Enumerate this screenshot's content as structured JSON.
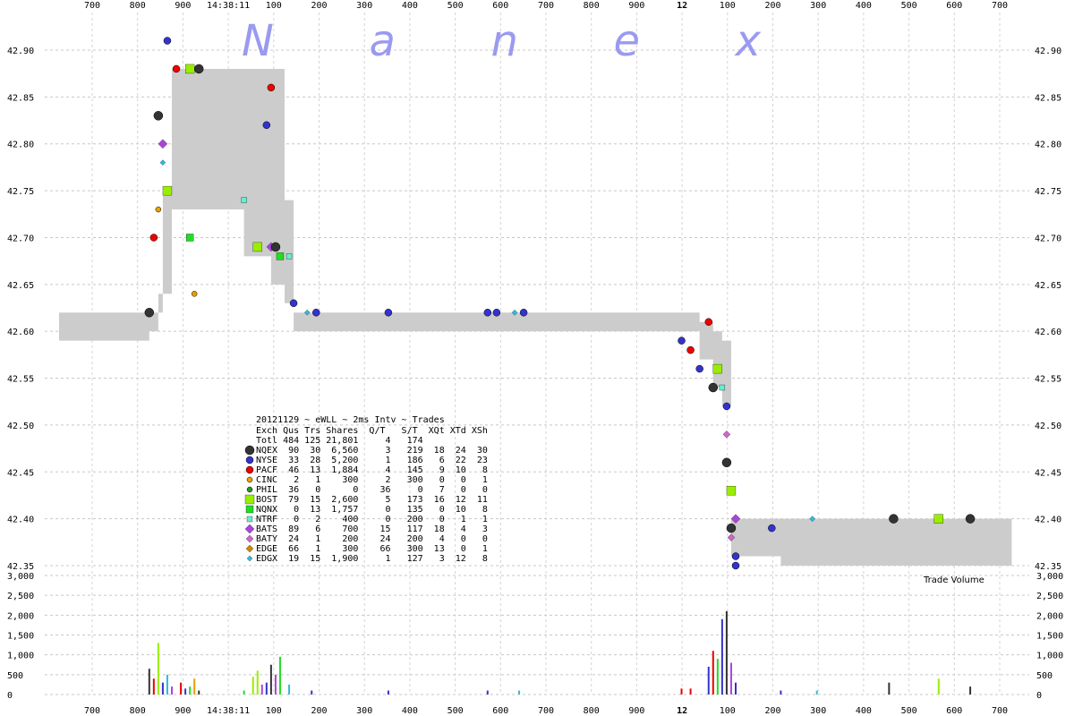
{
  "chart_data": {
    "type": "scatter",
    "watermark": "N a n e x",
    "top_ticks": [
      "700",
      "800",
      "900",
      "14:38:11",
      "100",
      "200",
      "300",
      "400",
      "500",
      "600",
      "700",
      "800",
      "900",
      "12",
      "100",
      "200",
      "300",
      "400",
      "500",
      "600",
      "700"
    ],
    "bottom_ticks": [
      "700",
      "800",
      "900",
      "14:38:11",
      "100",
      "200",
      "300",
      "400",
      "500",
      "600",
      "700",
      "800",
      "900",
      "12",
      "100",
      "200",
      "300",
      "400",
      "500",
      "600",
      "700"
    ],
    "price_ticks": [
      "42.90",
      "42.85",
      "42.80",
      "42.75",
      "42.70",
      "42.65",
      "42.60",
      "42.55",
      "42.50",
      "42.45",
      "42.40",
      "42.35"
    ],
    "price_range": [
      42.35,
      42.92
    ],
    "volume_ticks": [
      "3,000",
      "2,500",
      "2,000",
      "1,500",
      "1,000",
      "500",
      "0"
    ],
    "volume_range": [
      0,
      3000
    ],
    "volume_label": "Trade Volume",
    "nbbo_band": [
      {
        "t": 0.0,
        "bid": 42.59,
        "ask": 42.62
      },
      {
        "t": 2.0,
        "bid": 42.6,
        "ask": 42.62
      },
      {
        "t": 2.2,
        "bid": 42.62,
        "ask": 42.64
      },
      {
        "t": 2.3,
        "bid": 42.64,
        "ask": 42.75
      },
      {
        "t": 2.5,
        "bid": 42.73,
        "ask": 42.88
      },
      {
        "t": 2.8,
        "bid": 42.73,
        "ask": 42.88
      },
      {
        "t": 4.0,
        "bid": 42.73,
        "ask": 42.88
      },
      {
        "t": 4.1,
        "bid": 42.68,
        "ask": 42.88
      },
      {
        "t": 4.7,
        "bid": 42.65,
        "ask": 42.88
      },
      {
        "t": 5.0,
        "bid": 42.63,
        "ask": 42.74
      },
      {
        "t": 5.2,
        "bid": 42.6,
        "ask": 42.62
      },
      {
        "t": 14.0,
        "bid": 42.6,
        "ask": 42.62
      },
      {
        "t": 14.2,
        "bid": 42.57,
        "ask": 42.61
      },
      {
        "t": 14.5,
        "bid": 42.54,
        "ask": 42.6
      },
      {
        "t": 14.7,
        "bid": 42.52,
        "ask": 42.59
      },
      {
        "t": 14.9,
        "bid": 42.36,
        "ask": 42.4
      },
      {
        "t": 16.0,
        "bid": 42.35,
        "ask": 42.4
      },
      {
        "t": 21.0,
        "bid": 42.35,
        "ask": 42.4
      }
    ],
    "trades": [
      {
        "t": 2.0,
        "p": 42.62,
        "exch": "NQEX"
      },
      {
        "t": 2.4,
        "p": 42.91,
        "exch": "NYSE"
      },
      {
        "t": 2.6,
        "p": 42.88,
        "exch": "PACF"
      },
      {
        "t": 2.9,
        "p": 42.88,
        "exch": "BOST"
      },
      {
        "t": 3.1,
        "p": 42.88,
        "exch": "NQEX"
      },
      {
        "t": 2.2,
        "p": 42.83,
        "exch": "NQEX"
      },
      {
        "t": 2.3,
        "p": 42.8,
        "exch": "BATS"
      },
      {
        "t": 2.3,
        "p": 42.78,
        "exch": "EDGX"
      },
      {
        "t": 2.4,
        "p": 42.75,
        "exch": "BOST"
      },
      {
        "t": 2.2,
        "p": 42.73,
        "exch": "CINC"
      },
      {
        "t": 2.1,
        "p": 42.7,
        "exch": "PACF"
      },
      {
        "t": 2.9,
        "p": 42.7,
        "exch": "NQNX"
      },
      {
        "t": 3.0,
        "p": 42.64,
        "exch": "CINC"
      },
      {
        "t": 4.7,
        "p": 42.86,
        "exch": "PACF"
      },
      {
        "t": 4.6,
        "p": 42.82,
        "exch": "NYSE"
      },
      {
        "t": 4.1,
        "p": 42.74,
        "exch": "NTRF"
      },
      {
        "t": 4.4,
        "p": 42.69,
        "exch": "BOST"
      },
      {
        "t": 4.7,
        "p": 42.69,
        "exch": "BATS"
      },
      {
        "t": 4.8,
        "p": 42.69,
        "exch": "NQEX"
      },
      {
        "t": 4.9,
        "p": 42.68,
        "exch": "NQNX"
      },
      {
        "t": 5.1,
        "p": 42.68,
        "exch": "NTRF"
      },
      {
        "t": 5.2,
        "p": 42.63,
        "exch": "NYSE"
      },
      {
        "t": 5.5,
        "p": 42.62,
        "exch": "EDGX"
      },
      {
        "t": 5.7,
        "p": 42.62,
        "exch": "NYSE"
      },
      {
        "t": 7.3,
        "p": 42.62,
        "exch": "NYSE"
      },
      {
        "t": 9.5,
        "p": 42.62,
        "exch": "NYSE"
      },
      {
        "t": 9.7,
        "p": 42.62,
        "exch": "NYSE"
      },
      {
        "t": 10.1,
        "p": 42.62,
        "exch": "EDGX"
      },
      {
        "t": 10.3,
        "p": 42.62,
        "exch": "NYSE"
      },
      {
        "t": 13.8,
        "p": 42.59,
        "exch": "NYSE"
      },
      {
        "t": 14.0,
        "p": 42.58,
        "exch": "PACF"
      },
      {
        "t": 14.2,
        "p": 42.56,
        "exch": "NYSE"
      },
      {
        "t": 14.4,
        "p": 42.61,
        "exch": "PACF"
      },
      {
        "t": 14.6,
        "p": 42.56,
        "exch": "BOST"
      },
      {
        "t": 14.5,
        "p": 42.54,
        "exch": "NQEX"
      },
      {
        "t": 14.7,
        "p": 42.54,
        "exch": "NTRF"
      },
      {
        "t": 14.8,
        "p": 42.52,
        "exch": "NYSE"
      },
      {
        "t": 14.8,
        "p": 42.49,
        "exch": "BATY"
      },
      {
        "t": 14.8,
        "p": 42.46,
        "exch": "NQEX"
      },
      {
        "t": 14.9,
        "p": 42.43,
        "exch": "BOST"
      },
      {
        "t": 15.0,
        "p": 42.4,
        "exch": "BATS"
      },
      {
        "t": 14.9,
        "p": 42.39,
        "exch": "NQEX"
      },
      {
        "t": 14.9,
        "p": 42.38,
        "exch": "BATY"
      },
      {
        "t": 15.0,
        "p": 42.36,
        "exch": "NYSE"
      },
      {
        "t": 15.0,
        "p": 42.35,
        "exch": "NYSE"
      },
      {
        "t": 15.8,
        "p": 42.39,
        "exch": "NYSE"
      },
      {
        "t": 16.7,
        "p": 42.4,
        "exch": "EDGX"
      },
      {
        "t": 18.5,
        "p": 42.4,
        "exch": "NQEX"
      },
      {
        "t": 19.5,
        "p": 42.4,
        "exch": "BOST"
      },
      {
        "t": 20.2,
        "p": 42.4,
        "exch": "NQEX"
      }
    ],
    "volume": [
      {
        "t": 2.0,
        "v": 650,
        "exch": "NQEX"
      },
      {
        "t": 2.1,
        "v": 400,
        "exch": "PACF"
      },
      {
        "t": 2.2,
        "v": 1300,
        "exch": "BOST"
      },
      {
        "t": 2.3,
        "v": 300,
        "exch": "NYSE"
      },
      {
        "t": 2.4,
        "v": 500,
        "exch": "EDGX"
      },
      {
        "t": 2.5,
        "v": 200,
        "exch": "BATS"
      },
      {
        "t": 2.7,
        "v": 300,
        "exch": "PACF"
      },
      {
        "t": 2.8,
        "v": 150,
        "exch": "NYSE"
      },
      {
        "t": 2.9,
        "v": 200,
        "exch": "NQNX"
      },
      {
        "t": 3.0,
        "v": 400,
        "exch": "CINC"
      },
      {
        "t": 3.1,
        "v": 100,
        "exch": "NQEX"
      },
      {
        "t": 4.1,
        "v": 100,
        "exch": "NQNX"
      },
      {
        "t": 4.3,
        "v": 450,
        "exch": "BOST"
      },
      {
        "t": 4.4,
        "v": 600,
        "exch": "BOST"
      },
      {
        "t": 4.5,
        "v": 250,
        "exch": "BATS"
      },
      {
        "t": 4.6,
        "v": 300,
        "exch": "NYSE"
      },
      {
        "t": 4.7,
        "v": 750,
        "exch": "NQEX"
      },
      {
        "t": 4.8,
        "v": 500,
        "exch": "BATS"
      },
      {
        "t": 4.9,
        "v": 950,
        "exch": "NQNX"
      },
      {
        "t": 5.1,
        "v": 250,
        "exch": "EDGX"
      },
      {
        "t": 5.6,
        "v": 100,
        "exch": "NYSE"
      },
      {
        "t": 7.3,
        "v": 100,
        "exch": "NYSE"
      },
      {
        "t": 9.5,
        "v": 100,
        "exch": "NYSE"
      },
      {
        "t": 10.2,
        "v": 100,
        "exch": "EDGX"
      },
      {
        "t": 13.8,
        "v": 150,
        "exch": "PACF"
      },
      {
        "t": 14.0,
        "v": 150,
        "exch": "PACF"
      },
      {
        "t": 14.4,
        "v": 700,
        "exch": "NYSE"
      },
      {
        "t": 14.5,
        "v": 1100,
        "exch": "PACF"
      },
      {
        "t": 14.6,
        "v": 900,
        "exch": "NQNX"
      },
      {
        "t": 14.7,
        "v": 1900,
        "exch": "NYSE"
      },
      {
        "t": 14.8,
        "v": 2100,
        "exch": "NQEX"
      },
      {
        "t": 14.9,
        "v": 800,
        "exch": "BATS"
      },
      {
        "t": 15.0,
        "v": 300,
        "exch": "NYSE"
      },
      {
        "t": 16.0,
        "v": 100,
        "exch": "NYSE"
      },
      {
        "t": 16.8,
        "v": 100,
        "exch": "EDGX"
      },
      {
        "t": 18.4,
        "v": 300,
        "exch": "NQEX"
      },
      {
        "t": 19.5,
        "v": 400,
        "exch": "BOST"
      },
      {
        "t": 20.2,
        "v": 200,
        "exch": "NQEX"
      }
    ]
  },
  "legend": {
    "title": "20121129 ~ eWLL ~ 2ms Intv ~ Trades",
    "header": "Exch Qus Trs Shares  Q/T   S/T  XQt XTd XSh",
    "total": "Totl 484 125 21,801     4   174",
    "rows": [
      {
        "exch": "NQEX",
        "text": "NQEX  90  30  6,560     3   219  18  24  30",
        "color": "#333333",
        "shape": "circle-large"
      },
      {
        "exch": "NYSE",
        "text": "NYSE  33  28  5,200     1   186   6  22  23",
        "color": "#3333cc",
        "shape": "circle"
      },
      {
        "exch": "PACF",
        "text": "PACF  46  13  1,884     4   145   9  10   8",
        "color": "#ee0000",
        "shape": "circle"
      },
      {
        "exch": "CINC",
        "text": "CINC   2   1    300     2   300   0   0   1",
        "color": "#e6a000",
        "shape": "circle-small"
      },
      {
        "exch": "PHIL",
        "text": "PHIL  36   0      0    36     0   7   0   0",
        "color": "#229922",
        "shape": "circle-small"
      },
      {
        "exch": "BOST",
        "text": "BOST  79  15  2,600     5   173  16  12  11",
        "color": "#99ee00",
        "shape": "square-large"
      },
      {
        "exch": "NQNX",
        "text": "NQNX   0  13  1,757     0   135   0  10   8",
        "color": "#22dd22",
        "shape": "square"
      },
      {
        "exch": "NTRF",
        "text": "NTRF   0   2    400     0   200   0   1   1",
        "color": "#66eecc",
        "shape": "square-small"
      },
      {
        "exch": "BATS",
        "text": "BATS  89   6    700    15   117  18   4   3",
        "color": "#aa44dd",
        "shape": "diamond-large"
      },
      {
        "exch": "BATY",
        "text": "BATY  24   1    200    24   200   4   0   0",
        "color": "#cc66cc",
        "shape": "diamond"
      },
      {
        "exch": "EDGE",
        "text": "EDGE  66   1    300    66   300  13   0   1",
        "color": "#cc8800",
        "shape": "diamond"
      },
      {
        "exch": "EDGX",
        "text": "EDGX  19  15  1,900     1   127   3  12   8",
        "color": "#33bbdd",
        "shape": "diamond-small"
      }
    ]
  }
}
